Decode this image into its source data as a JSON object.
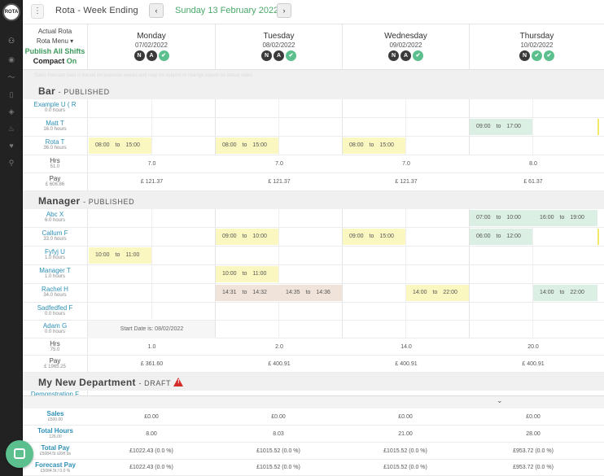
{
  "rail": {
    "logo": "ROTA",
    "icons": [
      "user-icon",
      "eye-icon",
      "chart-icon",
      "book-icon",
      "tag-icon",
      "fire-icon",
      "heart-icon",
      "pin-icon"
    ]
  },
  "topbar": {
    "title": "Rota - Week Ending",
    "prev": "‹",
    "date": "Sunday 13 February 2022",
    "next": "›",
    "menu": "⋮"
  },
  "controls": {
    "actual_rota": "Actual Rota",
    "rota_menu": "Rota Menu ▾",
    "publish_all": "Publish All Shifts",
    "compact_label": "Compact",
    "compact_state": "On"
  },
  "days": [
    {
      "name": "Monday",
      "date": "07/02/2022",
      "icons": [
        "N",
        "A",
        "✔"
      ]
    },
    {
      "name": "Tuesday",
      "date": "08/02/2022",
      "icons": [
        "N",
        "A",
        "✔"
      ]
    },
    {
      "name": "Wednesday",
      "date": "09/02/2022",
      "icons": [
        "N",
        "A",
        "✔"
      ]
    },
    {
      "name": "Thursday",
      "date": "10/02/2022",
      "icons": [
        "N",
        "✔",
        "✔"
      ]
    }
  ],
  "notice": "Sales forecast data is based on previous weeks and may be subject to change based on actual sales",
  "sections": {
    "bar": {
      "title": "Bar",
      "status": "PUBLISHED"
    },
    "manager": {
      "title": "Manager",
      "status": "PUBLISHED"
    },
    "newdept": {
      "title": "My New Department",
      "status": "DRAFT",
      "warn": "!"
    }
  },
  "bar_staff": [
    {
      "name": "Example U ( R",
      "hours": "0.0 hours"
    },
    {
      "name": "Matt T",
      "hours": "16.0 hours"
    },
    {
      "name": "Rota T",
      "hours": "36.0 hours"
    }
  ],
  "bar_shifts": {
    "matt_thu": {
      "start": "09:00",
      "to": "to",
      "end": "17:00"
    },
    "rota_mon": {
      "start": "08:00",
      "to": "to",
      "end": "15:00"
    },
    "rota_tue": {
      "start": "08:00",
      "to": "to",
      "end": "15:00"
    },
    "rota_wed": {
      "start": "08:00",
      "to": "to",
      "end": "15:00"
    }
  },
  "bar_totals": {
    "hrs_label": "Hrs",
    "hrs_value": "51.0",
    "pay_label": "Pay",
    "pay_value": "£ 606.86",
    "hrs": [
      "7.0",
      "7.0",
      "7.0",
      "8.0"
    ],
    "pay": [
      "£ 121.37",
      "£ 121.37",
      "£ 121.37",
      "£ 61.37"
    ]
  },
  "manager_staff": [
    {
      "name": "Abc X",
      "hours": "6.0 hours"
    },
    {
      "name": "Callum F",
      "hours": "33.0 hours"
    },
    {
      "name": "Fyfyj U",
      "hours": "1.0 hours"
    },
    {
      "name": "Manager T",
      "hours": "1.0 hours"
    },
    {
      "name": "Rachel H",
      "hours": "34.0 hours"
    },
    {
      "name": "Sadfedfed F",
      "hours": "0.0 hours"
    },
    {
      "name": "Adam G",
      "hours": "0.0 hours"
    }
  ],
  "manager_shifts": {
    "abc_thu1": {
      "start": "07:00",
      "to": "to",
      "end": "10:00"
    },
    "abc_thu2": {
      "start": "16:00",
      "to": "to",
      "end": "19:00"
    },
    "callum_tue": {
      "start": "09:00",
      "to": "to",
      "end": "10:00"
    },
    "callum_wed": {
      "start": "09:00",
      "to": "to",
      "end": "15:00"
    },
    "callum_thu": {
      "start": "06:00",
      "to": "to",
      "end": "12:00"
    },
    "fyfyj_mon": {
      "start": "10:00",
      "to": "to",
      "end": "11:00"
    },
    "manager_tue": {
      "start": "10:00",
      "to": "to",
      "end": "11:00"
    },
    "rachel_tue1": {
      "start": "14:31",
      "to": "to",
      "end": "14:32"
    },
    "rachel_tue2": {
      "start": "14:35",
      "to": "to",
      "end": "14:36"
    },
    "rachel_wed": {
      "start": "14:00",
      "to": "to",
      "end": "22:00"
    },
    "rachel_thu": {
      "start": "14:00",
      "to": "to",
      "end": "22:00"
    }
  },
  "adam_note": "Start Date is: 08/02/2022",
  "manager_totals": {
    "hrs_label": "Hrs",
    "hrs_value": "75.0",
    "pay_label": "Pay",
    "pay_value": "£ 1965.25",
    "hrs": [
      "1.0",
      "2.0",
      "14.0",
      "20.0"
    ],
    "pay": [
      "£ 361.60",
      "£ 400.91",
      "£ 400.91",
      "£ 400.91"
    ]
  },
  "newdept_staff": [
    {
      "name": "Demonstration F",
      "hours": ""
    }
  ],
  "summary": {
    "chevron": "⌄",
    "rows": [
      {
        "label": "Sales",
        "sub": "£500.00",
        "values": [
          "£0.00",
          "£0.00",
          "£0.00",
          "£0.00"
        ]
      },
      {
        "label": "Total Hours",
        "sub": "126.00",
        "values": [
          "8.00",
          "8.03",
          "21.00",
          "28.00"
        ]
      },
      {
        "label": "Total Pay",
        "sub": "£5084.5t /£6H.9s",
        "values": [
          "£1022.43 (0.0 %)",
          "£1015.52 (0.0 %)",
          "£1015.52 (0.0 %)",
          "£953.72 (0.0 %)"
        ]
      },
      {
        "label": "Forecast Pay",
        "sub": "£5084.5t / 0.0 %",
        "values": [
          "£1022.43 (0.0 %)",
          "£1015.52 (0.0 %)",
          "£1015.52 (0.0 %)",
          "£953.72 (0.0 %)"
        ]
      }
    ]
  }
}
